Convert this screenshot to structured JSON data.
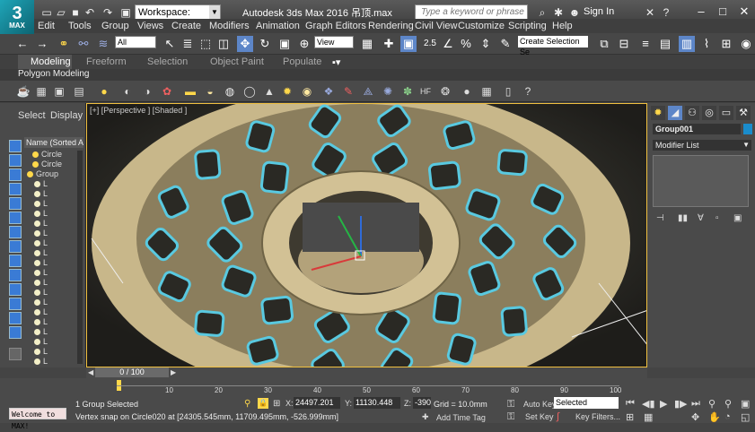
{
  "titlebar": {
    "workspace": "Workspace: Default",
    "app_title": "Autodesk 3ds Max 2016     吊顶.max",
    "search_placeholder": "Type a keyword or phrase",
    "signin": "Sign In",
    "logo_text": "MAX"
  },
  "menu": [
    "Edit",
    "Tools",
    "Group",
    "Views",
    "Create",
    "Modifiers",
    "Animation",
    "Graph Editors",
    "Rendering",
    "Civil View",
    "Customize",
    "Scripting",
    "Help"
  ],
  "toolbar": {
    "selection_filter": "All",
    "ref_coord": "View",
    "named_selection": "Create Selection Se",
    "snap_value": "2.5"
  },
  "ribbon": {
    "tabs": [
      "Modeling",
      "Freeform",
      "Selection",
      "Object Paint",
      "Populate"
    ],
    "sub_label": "Polygon Modeling"
  },
  "scene_explorer": {
    "tabs": [
      "Select",
      "Display"
    ],
    "header": "Name (Sorted As",
    "rows": [
      "Circle",
      "Circle",
      "Group",
      "L",
      "L",
      "L",
      "L",
      "L",
      "L",
      "L",
      "L",
      "L",
      "L",
      "L",
      "L",
      "L",
      "L",
      "L",
      "L",
      "L",
      "L",
      "L"
    ]
  },
  "viewport": {
    "label": "[+] [Perspective ] [Shaded ]"
  },
  "command_panel": {
    "object_name": "Group001",
    "object_color": "#1a8ccc",
    "modifier_list": "Modifier List"
  },
  "timeline": {
    "slider": "0 / 100",
    "ticks": [
      "10",
      "20",
      "30",
      "40",
      "50",
      "60",
      "70",
      "80",
      "90",
      "100"
    ]
  },
  "status": {
    "maxscript": "Welcome to MAX!",
    "selection_info": "1 Group Selected",
    "prompt": "Vertex snap on Circle020 at [24305.545mm, 11709.495mm, -526.999mm]",
    "x": "24497.201",
    "y": "11130.448",
    "z": "-390.116m",
    "x_label": "X:",
    "y_label": "Y:",
    "z_label": "Z:",
    "grid": "Grid = 10.0mm",
    "auto_key": "Auto Key",
    "set_key": "Set Key",
    "selected": "Selected",
    "key_filters": "Key Filters...",
    "add_time_tag": "Add Time Tag"
  }
}
